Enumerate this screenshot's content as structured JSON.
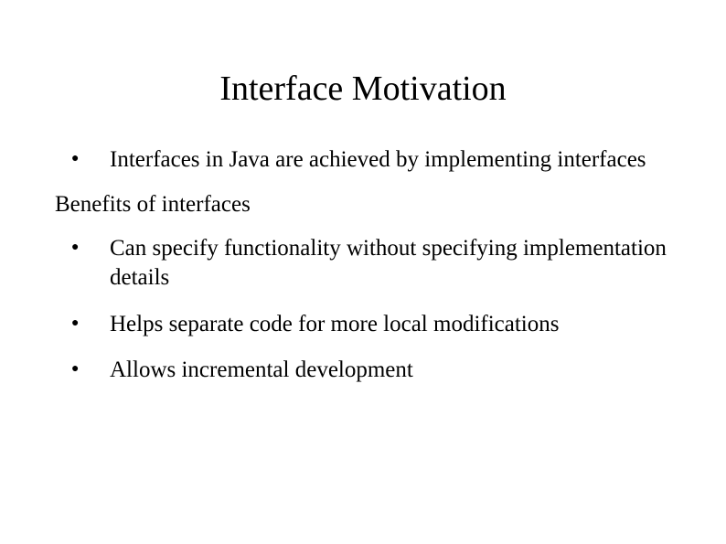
{
  "title": "Interface Motivation",
  "bullets_top": [
    "Interfaces in Java are achieved by implementing interfaces"
  ],
  "subheading": "Benefits of interfaces",
  "bullets_benefits": [
    "Can specify functionality without specifying implementation details",
    "Helps separate code for more local modifications",
    "Allows incremental development"
  ]
}
